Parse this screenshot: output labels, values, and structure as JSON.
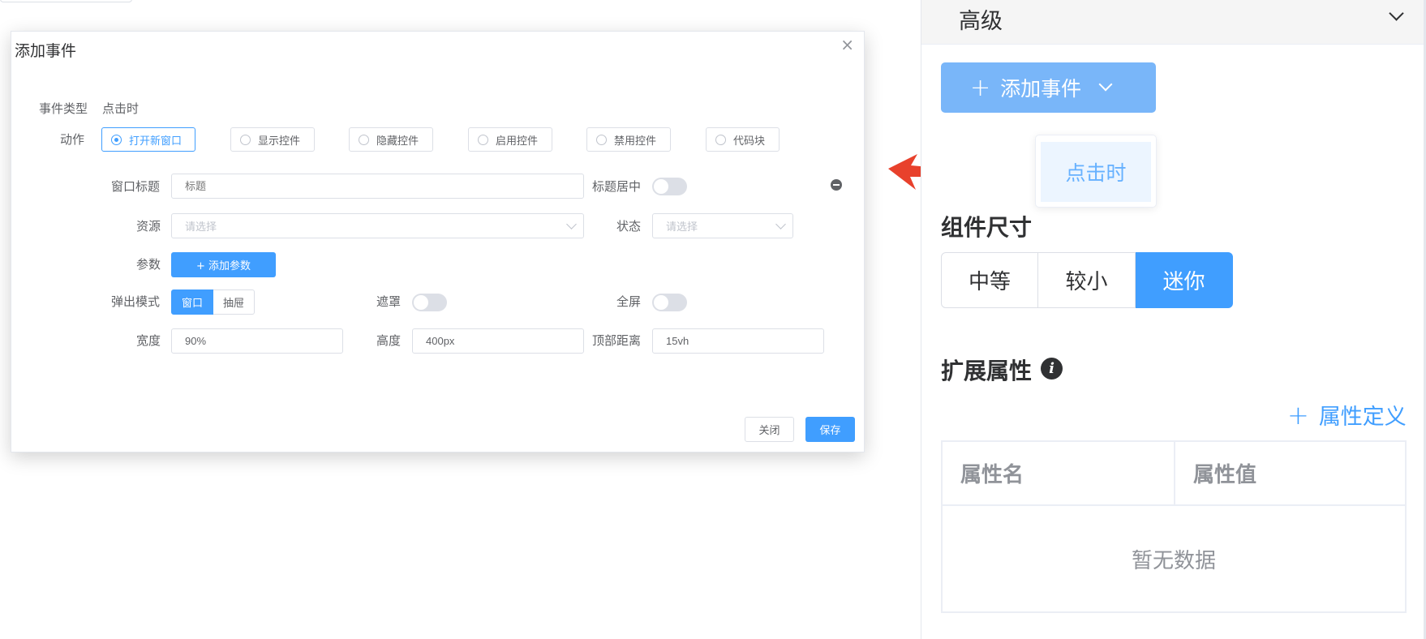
{
  "dialog": {
    "title": "添加事件",
    "close_glyph": "×",
    "event_type_label": "事件类型",
    "event_type_value": "点击时",
    "action_label": "动作",
    "actions": [
      {
        "label": "打开新窗口",
        "selected": true
      },
      {
        "label": "显示控件",
        "selected": false
      },
      {
        "label": "隐藏控件",
        "selected": false
      },
      {
        "label": "启用控件",
        "selected": false
      },
      {
        "label": "禁用控件",
        "selected": false
      },
      {
        "label": "代码块",
        "selected": false
      }
    ],
    "window_title_label": "窗口标题",
    "window_title_placeholder": "标题",
    "title_center_label": "标题居中",
    "title_center_on": false,
    "resource_label": "资源",
    "resource_placeholder": "请选择",
    "status_label": "状态",
    "status_placeholder": "请选择",
    "params_label": "参数",
    "add_param_label": "+ 添加参数",
    "popup_mode_label": "弹出模式",
    "popup_modes": [
      "窗口",
      "抽屉"
    ],
    "popup_mode_selected": "窗口",
    "mask_label": "遮罩",
    "mask_on": false,
    "fullscreen_label": "全屏",
    "fullscreen_on": false,
    "width_label": "宽度",
    "width_value": "90%",
    "height_label": "高度",
    "height_value": "400px",
    "top_distance_label": "顶部距离",
    "top_distance_value": "15vh",
    "close_button": "关闭",
    "save_button": "保存"
  },
  "right_panel": {
    "section_title": "高级",
    "add_event_button": "添加事件",
    "dropdown_items": [
      "点击时"
    ],
    "component_size_title": "组件尺寸",
    "sizes": [
      "中等",
      "较小",
      "迷你"
    ],
    "size_selected": "迷你",
    "ext_props_title": "扩展属性",
    "attr_define_button": "属性定义",
    "table_headers": [
      "属性名",
      "属性值"
    ],
    "table_empty_text": "暂无数据"
  },
  "colors": {
    "primary": "#409eff",
    "primary_light": "#79b6f9",
    "annotation_arrow": "#e8412c"
  }
}
